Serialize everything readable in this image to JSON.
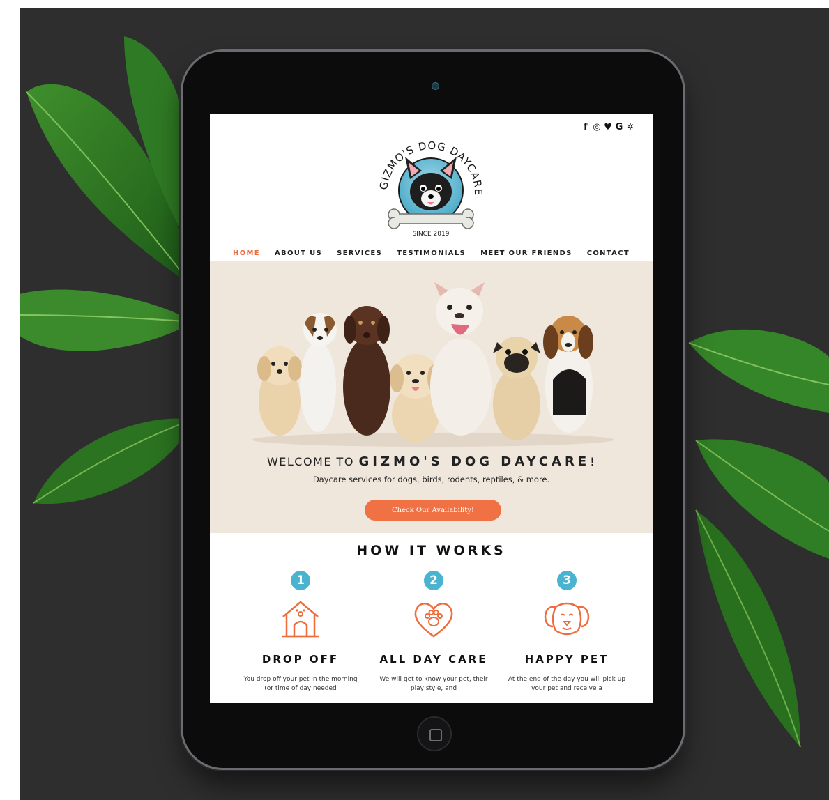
{
  "site": {
    "logo": {
      "arc_text": "GIZMO'S DOG DAYCARE",
      "since": "SINCE 2019"
    },
    "social_icons": [
      "facebook-icon",
      "instagram-icon",
      "twitter-icon",
      "google-icon",
      "yelp-icon"
    ],
    "social_glyphs": [
      "f",
      "◎",
      "♥",
      "G",
      "✲"
    ],
    "nav": {
      "items": [
        "HOME",
        "ABOUT US",
        "SERVICES",
        "TESTIMONIALS",
        "MEET OUR FRIENDS",
        "CONTACT"
      ],
      "active": "HOME"
    },
    "hero": {
      "welcome_prefix": "WELCOME TO",
      "welcome_brand": "GIZMO'S DOG DAYCARE",
      "welcome_suffix": "!",
      "tagline": "Daycare services for dogs, birds, rodents, reptiles, & more.",
      "cta_label": "Check Our Availability!"
    },
    "how_it_works": {
      "title": "HOW IT WORKS",
      "steps": [
        {
          "number": "1",
          "icon": "dog-house-icon",
          "title": "DROP OFF",
          "desc": "You drop off your pet in the morning (or time of day needed"
        },
        {
          "number": "2",
          "icon": "heart-paw-icon",
          "title": "ALL DAY CARE",
          "desc": "We will get to know your pet, their play style, and"
        },
        {
          "number": "3",
          "icon": "dog-face-icon",
          "title": "HAPPY PET",
          "desc": "At the end of the day you will pick up your pet and receive a"
        }
      ]
    }
  },
  "colors": {
    "accent_orange": "#f07144",
    "accent_blue": "#4ab3cf",
    "hero_bg": "#efe6dc",
    "backdrop": "#2e2e2f"
  }
}
